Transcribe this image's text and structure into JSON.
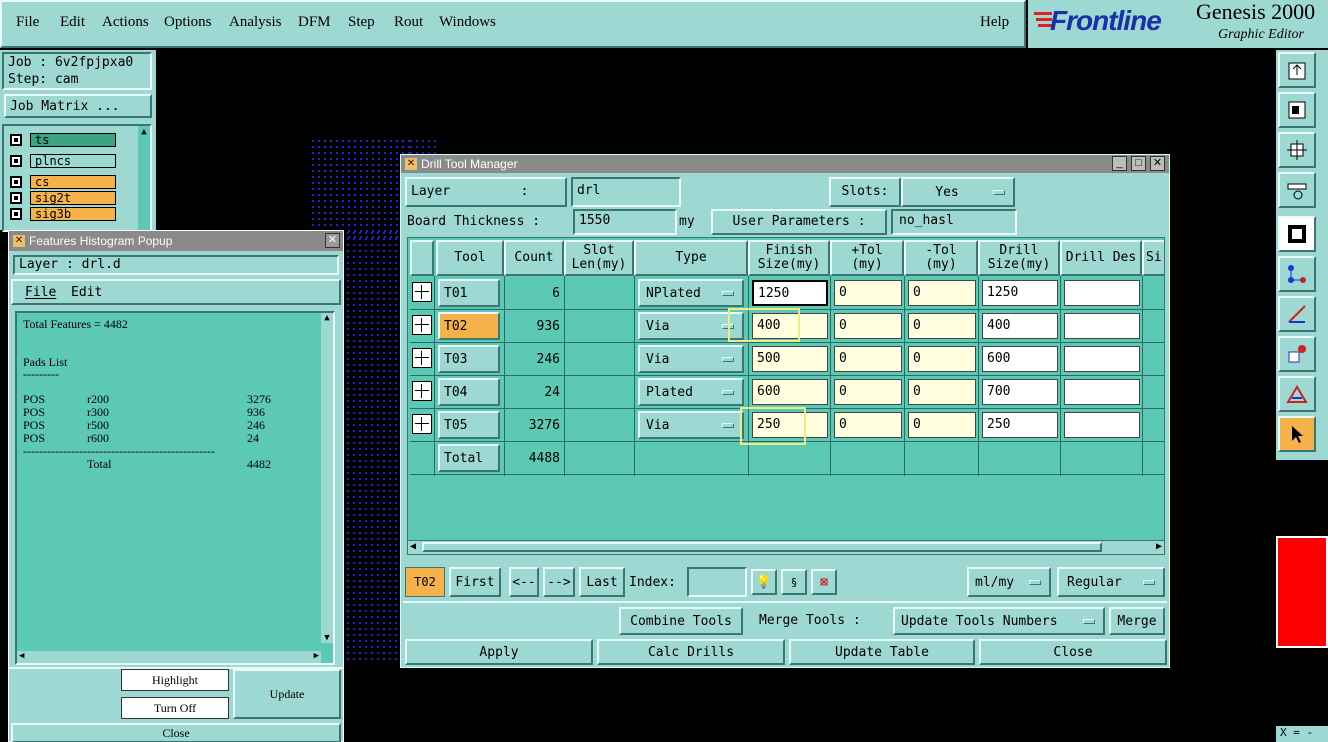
{
  "menu": {
    "items": [
      "File",
      "Edit",
      "Actions",
      "Options",
      "Analysis",
      "DFM",
      "Step",
      "Rout",
      "Windows"
    ],
    "help": "Help"
  },
  "brand": {
    "logo": "Frontline",
    "product": "Genesis 2000",
    "subtitle": "Graphic Editor"
  },
  "job": {
    "job_label": "Job : 6v2fpjpxa0",
    "step_label": "Step: cam",
    "matrix_button": "Job Matrix ..."
  },
  "layers": [
    {
      "name": "ts",
      "color": "#3aa37f"
    },
    {
      "name": "plncs",
      "color": "#9ed8d3"
    },
    {
      "name": "cs",
      "color": "#f5b24a"
    },
    {
      "name": "sig2t",
      "color": "#f5b24a"
    },
    {
      "name": "sig3b",
      "color": "#f5b24a"
    }
  ],
  "features": {
    "title": "Features Histogram Popup",
    "layer": "Layer :  drl.d",
    "menu_file": "File",
    "menu_edit": "Edit",
    "total_line": "Total Features = 4482",
    "pads_title": "Pads List",
    "underline": "---------",
    "rows": [
      {
        "type": "POS",
        "sym": "r200",
        "count": "3276"
      },
      {
        "type": "POS",
        "sym": "r300",
        "count": "936"
      },
      {
        "type": "POS",
        "sym": "r500",
        "count": "246"
      },
      {
        "type": "POS",
        "sym": "r600",
        "count": "24"
      }
    ],
    "separator": "------------------------------------------------",
    "total_label": "Total",
    "total_value": "4482",
    "highlight_button": "Highlight",
    "turnoff_button": "Turn Off",
    "update_button": "Update",
    "close_button": "Close"
  },
  "dtm": {
    "title": "Drill Tool Manager",
    "layer_label": "Layer         :",
    "layer_value": "drl",
    "slots_label": "Slots:",
    "slots_value": "Yes",
    "thickness_label": "Board Thickness :",
    "thickness_value": "1550",
    "thickness_unit": "my",
    "user_params_label": "User Parameters :",
    "user_params_value": "no_hasl",
    "columns": [
      "Tool",
      "Count",
      "Slot Len(my)",
      "Type",
      "Finish Size(my)",
      "+Tol (my)",
      "-Tol (my)",
      "Drill Size(my)",
      "Drill Des",
      "Si"
    ],
    "rows": [
      {
        "tool": "T01",
        "count": "6",
        "type": "NPlated",
        "finish": "1250",
        "ptol": "0",
        "mtol": "0",
        "drill": "1250",
        "des": ""
      },
      {
        "tool": "T02",
        "count": "936",
        "type": "Via",
        "finish": "400",
        "ptol": "0",
        "mtol": "0",
        "drill": "400",
        "des": ""
      },
      {
        "tool": "T03",
        "count": "246",
        "type": "Via",
        "finish": "500",
        "ptol": "0",
        "mtol": "0",
        "drill": "600",
        "des": ""
      },
      {
        "tool": "T04",
        "count": "24",
        "type": "Plated",
        "finish": "600",
        "ptol": "0",
        "mtol": "0",
        "drill": "700",
        "des": ""
      },
      {
        "tool": "T05",
        "count": "3276",
        "type": "Via",
        "finish": "250",
        "ptol": "0",
        "mtol": "0",
        "drill": "250",
        "des": ""
      }
    ],
    "total_label": "Total",
    "total_count": "4488",
    "selected_tool": "T02",
    "nav": {
      "first": "First",
      "prev": "<--",
      "next": "-->",
      "last": "Last",
      "index_label": "Index:",
      "index_value": ""
    },
    "units_value": "ml/my",
    "mode_value": "Regular",
    "combine_button": "Combine Tools",
    "merge_label": "Merge Tools :",
    "merge_option": "Update Tools Numbers",
    "merge_button": "Merge",
    "apply_button": "Apply",
    "calc_button": "Calc Drills",
    "update_table_button": "Update Table",
    "close_button": "Close"
  },
  "status": {
    "coord_prefix": "X = -"
  }
}
